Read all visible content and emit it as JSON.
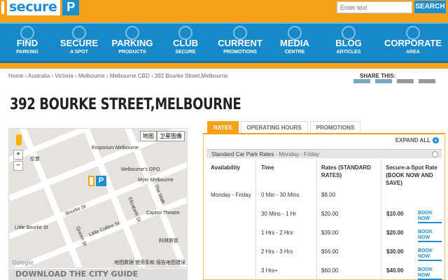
{
  "header": {
    "logo_text": "secure",
    "logo_mark": "P",
    "search_placeholder": "Enter text",
    "search_button": "SEARCH"
  },
  "nav": [
    {
      "title": "FIND",
      "sub": "PARKING",
      "icon": "search-icon"
    },
    {
      "title": "SECURE",
      "sub": "A SPOT",
      "icon": "badge-icon"
    },
    {
      "title": "PARKING",
      "sub": "PRODUCTS",
      "icon": "tag-icon"
    },
    {
      "title": "CLUB",
      "sub": "SECURE",
      "icon": "card-icon"
    },
    {
      "title": "CURRENT",
      "sub": "PROMOTIONS",
      "icon": "price-tag-icon"
    },
    {
      "title": "MEDIA",
      "sub": "CENTRE",
      "icon": "media-icon"
    },
    {
      "title": "BLOG",
      "sub": "ARTICLES",
      "icon": "speech-bubble-icon"
    },
    {
      "title": "CORPORATE",
      "sub": "AREA",
      "icon": "building-icon"
    }
  ],
  "breadcrumb": [
    "Home",
    "Australia",
    "Victoria",
    "Melbourne",
    "Melbourne CBD",
    "392 Bourke Street,Melbourne"
  ],
  "share_label": "SHARE THIS:",
  "page_title": "392 BOURKE STREET,MELBOURNE",
  "map": {
    "tab_map": "地图",
    "tab_satellite": "卫星图像",
    "labels": [
      "Emporium Melbourne",
      "Melbourne's GPO",
      "Myer Melbourne",
      "Little Bourke St",
      "Bourke St",
      "Little Collins St",
      "Queen St",
      "Elizabeth St",
      "Capitol Theatre",
      "伦敦",
      "科林斯街",
      "The Walk"
    ],
    "footer": "地图数据  使用条款  报告地图错误",
    "google": "Google"
  },
  "guide_banner": "DOWNLOAD THE CITY GUIDE",
  "tabs": [
    "RATES",
    "OPERATING HOURS",
    "PROMOTIONS"
  ],
  "expand_all": "EXPAND ALL",
  "rates": {
    "section_title": "Standard Car Park Rates",
    "section_sub": " - Monday - Friday",
    "headers": [
      "Availability",
      "Time",
      "Rates (STANDARD RATES)",
      "Secure-a-Spot Rate (BOOK NOW AND SAVE)"
    ],
    "book_label": "BOOK NOW",
    "rows": [
      {
        "availability": "Monday - Friday",
        "time": "0 Min - 30 Mins",
        "rate": "$8.00",
        "secure": ""
      },
      {
        "availability": "",
        "time": "30 Mins - 1 Hr",
        "rate": "$20.00",
        "secure": "$10.00"
      },
      {
        "availability": "",
        "time": "1 Hrs - 2 Hrs",
        "rate": "$39.00",
        "secure": "$20.00"
      },
      {
        "availability": "",
        "time": "2 Hrs - 3 Hrs",
        "rate": "$56.00",
        "secure": "$30.00"
      },
      {
        "availability": "",
        "time": "3 Hrs+",
        "rate": "$60.00",
        "secure": "$40.00"
      }
    ]
  }
}
